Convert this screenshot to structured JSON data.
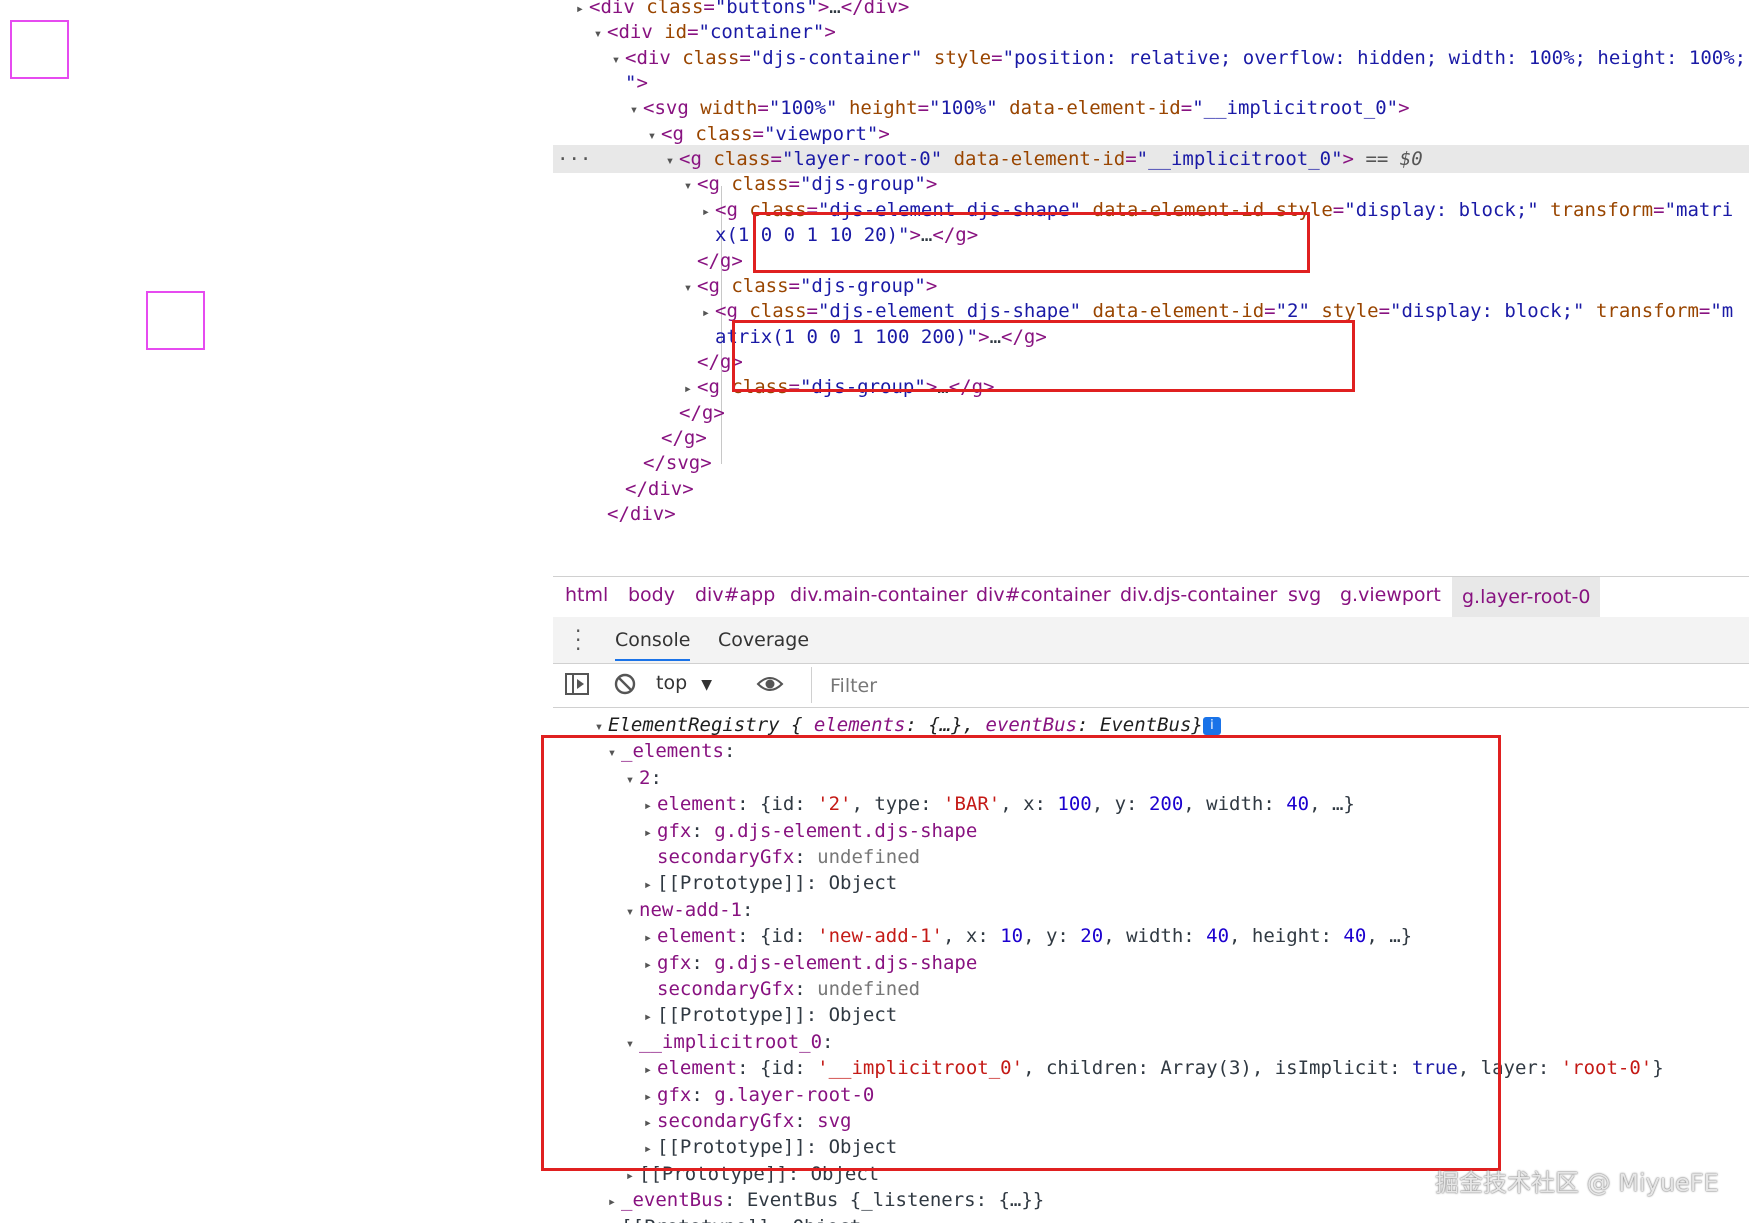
{
  "elements_panel": {
    "lines": [
      {
        "ind": 0,
        "tri": "▸",
        "parts": [
          [
            "tag",
            "<div "
          ],
          [
            "an",
            "class"
          ],
          [
            "tag",
            "="
          ],
          [
            "av",
            "\"buttons\""
          ],
          [
            "tag",
            ">"
          ],
          [
            "pl",
            "…"
          ],
          [
            "tag",
            "</div>"
          ]
        ]
      },
      {
        "ind": 1,
        "tri": "▾",
        "parts": [
          [
            "tag",
            "<div "
          ],
          [
            "an",
            "id"
          ],
          [
            "tag",
            "="
          ],
          [
            "av",
            "\"container\""
          ],
          [
            "tag",
            ">"
          ]
        ]
      },
      {
        "ind": 2,
        "tri": "▾",
        "parts": [
          [
            "tag",
            "<div "
          ],
          [
            "an",
            "class"
          ],
          [
            "tag",
            "="
          ],
          [
            "av",
            "\"djs-container\""
          ],
          [
            "tag",
            " "
          ],
          [
            "an",
            "style"
          ],
          [
            "tag",
            "="
          ],
          [
            "av",
            "\"position: relative; overflow: hidden; width: 100%; height: 100%;"
          ]
        ]
      },
      {
        "ind": 2,
        "tri": "",
        "parts": [
          [
            "av",
            "\""
          ],
          [
            "tag",
            ">"
          ]
        ]
      },
      {
        "ind": 3,
        "tri": "▾",
        "parts": [
          [
            "tag",
            "<svg "
          ],
          [
            "an",
            "width"
          ],
          [
            "tag",
            "="
          ],
          [
            "av",
            "\"100%\""
          ],
          [
            "tag",
            " "
          ],
          [
            "an",
            "height"
          ],
          [
            "tag",
            "="
          ],
          [
            "av",
            "\"100%\""
          ],
          [
            "tag",
            " "
          ],
          [
            "an",
            "data-element-id"
          ],
          [
            "tag",
            "="
          ],
          [
            "av",
            "\"__implicitroot_0\""
          ],
          [
            "tag",
            ">"
          ]
        ]
      },
      {
        "ind": 4,
        "tri": "▾",
        "parts": [
          [
            "tag",
            "<g "
          ],
          [
            "an",
            "class"
          ],
          [
            "tag",
            "="
          ],
          [
            "av",
            "\"viewport\""
          ],
          [
            "tag",
            ">"
          ]
        ]
      },
      {
        "ind": 5,
        "tri": "▾",
        "selected": true,
        "parts": [
          [
            "tag",
            "<g "
          ],
          [
            "an",
            "class"
          ],
          [
            "tag",
            "="
          ],
          [
            "av",
            "\"layer-root-0\""
          ],
          [
            "tag",
            " "
          ],
          [
            "an",
            "data-element-id"
          ],
          [
            "tag",
            "="
          ],
          [
            "av",
            "\"__implicitroot_0\""
          ],
          [
            "tag",
            ">"
          ],
          [
            "eq",
            " == $0"
          ]
        ]
      },
      {
        "ind": 6,
        "tri": "▾",
        "parts": [
          [
            "tag",
            "<g "
          ],
          [
            "an",
            "class"
          ],
          [
            "tag",
            "="
          ],
          [
            "av",
            "\"djs-group\""
          ],
          [
            "tag",
            ">"
          ]
        ]
      },
      {
        "ind": 7,
        "tri": "▸",
        "parts": [
          [
            "tag",
            "<g "
          ],
          [
            "an",
            "class"
          ],
          [
            "tag",
            "="
          ],
          [
            "av",
            "\"djs-element djs-shape\""
          ],
          [
            "tag",
            " "
          ],
          [
            "an",
            "data-element-id"
          ],
          [
            "tag",
            " "
          ],
          [
            "an",
            "style"
          ],
          [
            "tag",
            "="
          ],
          [
            "av",
            "\"display: block;\""
          ],
          [
            "tag",
            " "
          ],
          [
            "an",
            "transform"
          ],
          [
            "tag",
            "="
          ],
          [
            "av",
            "\"matri"
          ]
        ]
      },
      {
        "ind": 7,
        "tri": "",
        "parts": [
          [
            "av",
            "x(1 0 0 1 10 20)\""
          ],
          [
            "tag",
            ">"
          ],
          [
            "pl",
            "…"
          ],
          [
            "tag",
            "</g>"
          ]
        ]
      },
      {
        "ind": 6,
        "tri": "",
        "parts": [
          [
            "tag",
            "</g>"
          ]
        ]
      },
      {
        "ind": 6,
        "tri": "▾",
        "parts": [
          [
            "tag",
            "<g "
          ],
          [
            "an",
            "class"
          ],
          [
            "tag",
            "="
          ],
          [
            "av",
            "\"djs-group\""
          ],
          [
            "tag",
            ">"
          ]
        ]
      },
      {
        "ind": 7,
        "tri": "▸",
        "parts": [
          [
            "tag",
            "<g "
          ],
          [
            "an",
            "class"
          ],
          [
            "tag",
            "="
          ],
          [
            "av",
            "\"djs-element djs-shape\""
          ],
          [
            "tag",
            " "
          ],
          [
            "an",
            "data-element-id"
          ],
          [
            "tag",
            "="
          ],
          [
            "av",
            "\"2\""
          ],
          [
            "tag",
            " "
          ],
          [
            "an",
            "style"
          ],
          [
            "tag",
            "="
          ],
          [
            "av",
            "\"display: block;\""
          ],
          [
            "tag",
            " "
          ],
          [
            "an",
            "transform"
          ],
          [
            "tag",
            "="
          ],
          [
            "av",
            "\"m"
          ]
        ]
      },
      {
        "ind": 7,
        "tri": "",
        "parts": [
          [
            "av",
            "atrix(1 0 0 1 100 200)\""
          ],
          [
            "tag",
            ">"
          ],
          [
            "pl",
            "…"
          ],
          [
            "tag",
            "</g>"
          ]
        ]
      },
      {
        "ind": 6,
        "tri": "",
        "parts": [
          [
            "tag",
            "</g>"
          ]
        ]
      },
      {
        "ind": 6,
        "tri": "▸",
        "parts": [
          [
            "tag",
            "<g "
          ],
          [
            "an",
            "class"
          ],
          [
            "tag",
            "="
          ],
          [
            "av",
            "\"djs-group\""
          ],
          [
            "tag",
            ">"
          ],
          [
            "pl",
            "…"
          ],
          [
            "tag",
            "</g>"
          ]
        ]
      },
      {
        "ind": 5,
        "tri": "",
        "parts": [
          [
            "tag",
            "</g>"
          ]
        ]
      },
      {
        "ind": 4,
        "tri": "",
        "parts": [
          [
            "tag",
            "</g>"
          ]
        ]
      },
      {
        "ind": 3,
        "tri": "",
        "parts": [
          [
            "tag",
            "</svg>"
          ]
        ]
      },
      {
        "ind": 2,
        "tri": "",
        "parts": [
          [
            "tag",
            "</div>"
          ]
        ]
      },
      {
        "ind": 1,
        "tri": "",
        "parts": [
          [
            "tag",
            "</div>"
          ]
        ]
      }
    ],
    "more_dots": "···"
  },
  "breadcrumbs": [
    "html",
    "body",
    "div#app",
    "div.main-container",
    "div#container",
    "div.djs-container",
    "svg",
    "g.viewport",
    "g.layer-root-0"
  ],
  "drawer_tabs": [
    "Console",
    "Coverage"
  ],
  "toolbar": {
    "context": "top",
    "filter_placeholder": "Filter"
  },
  "console": {
    "lines": [
      {
        "ind": 0,
        "tri": "▾",
        "parts": [
          [
            "it",
            "ElementRegistry {"
          ],
          [
            "it",
            " "
          ],
          [
            "itk",
            "elements"
          ],
          [
            "it",
            ": {…}, "
          ],
          [
            "itk",
            "eventBus"
          ],
          [
            "it",
            ": EventBus}"
          ],
          [
            "info",
            "i"
          ]
        ]
      },
      {
        "ind": 1,
        "tri": "▾",
        "parts": [
          [
            "k",
            "_elements"
          ],
          [
            "pl",
            ":"
          ]
        ]
      },
      {
        "ind": 2,
        "tri": "▾",
        "parts": [
          [
            "k",
            "2"
          ],
          [
            "pl",
            ":"
          ]
        ]
      },
      {
        "ind": 3,
        "tri": "▸",
        "parts": [
          [
            "k",
            "element"
          ],
          [
            "pl",
            ": {id: "
          ],
          [
            "str",
            "'2'"
          ],
          [
            "pl",
            ", type: "
          ],
          [
            "str",
            "'BAR'"
          ],
          [
            "pl",
            ", x: "
          ],
          [
            "num",
            "100"
          ],
          [
            "pl",
            ", y: "
          ],
          [
            "num",
            "200"
          ],
          [
            "pl",
            ", width: "
          ],
          [
            "num",
            "40"
          ],
          [
            "pl",
            ", …}"
          ]
        ]
      },
      {
        "ind": 3,
        "tri": "▸",
        "parts": [
          [
            "k",
            "gfx"
          ],
          [
            "pl",
            ": "
          ],
          [
            "k",
            "g.djs-element.djs-shape"
          ]
        ]
      },
      {
        "ind": 3,
        "tri": "",
        "parts": [
          [
            "k",
            "secondaryGfx"
          ],
          [
            "pl",
            ": "
          ],
          [
            "undef",
            "undefined"
          ]
        ]
      },
      {
        "ind": 3,
        "tri": "▸",
        "parts": [
          [
            "pl",
            "[[Prototype]]: Object"
          ]
        ]
      },
      {
        "ind": 2,
        "tri": "▾",
        "parts": [
          [
            "k",
            "new-add-1"
          ],
          [
            "pl",
            ":"
          ]
        ]
      },
      {
        "ind": 3,
        "tri": "▸",
        "parts": [
          [
            "k",
            "element"
          ],
          [
            "pl",
            ": {id: "
          ],
          [
            "str",
            "'new-add-1'"
          ],
          [
            "pl",
            ", x: "
          ],
          [
            "num",
            "10"
          ],
          [
            "pl",
            ", y: "
          ],
          [
            "num",
            "20"
          ],
          [
            "pl",
            ", width: "
          ],
          [
            "num",
            "40"
          ],
          [
            "pl",
            ", height: "
          ],
          [
            "num",
            "40"
          ],
          [
            "pl",
            ", …}"
          ]
        ]
      },
      {
        "ind": 3,
        "tri": "▸",
        "parts": [
          [
            "k",
            "gfx"
          ],
          [
            "pl",
            ": "
          ],
          [
            "k",
            "g.djs-element.djs-shape"
          ]
        ]
      },
      {
        "ind": 3,
        "tri": "",
        "parts": [
          [
            "k",
            "secondaryGfx"
          ],
          [
            "pl",
            ": "
          ],
          [
            "undef",
            "undefined"
          ]
        ]
      },
      {
        "ind": 3,
        "tri": "▸",
        "parts": [
          [
            "pl",
            "[[Prototype]]: Object"
          ]
        ]
      },
      {
        "ind": 2,
        "tri": "▾",
        "parts": [
          [
            "k",
            "__implicitroot_0"
          ],
          [
            "pl",
            ":"
          ]
        ]
      },
      {
        "ind": 3,
        "tri": "▸",
        "parts": [
          [
            "k",
            "element"
          ],
          [
            "pl",
            ": {id: "
          ],
          [
            "str",
            "'__implicitroot_0'"
          ],
          [
            "pl",
            ", children: Array(3), isImplicit: "
          ],
          [
            "kw",
            "true"
          ],
          [
            "pl",
            ", layer: "
          ],
          [
            "str",
            "'root-0'"
          ],
          [
            "pl",
            "}"
          ]
        ]
      },
      {
        "ind": 3,
        "tri": "▸",
        "parts": [
          [
            "k",
            "gfx"
          ],
          [
            "pl",
            ": "
          ],
          [
            "k",
            "g.layer-root-0"
          ]
        ]
      },
      {
        "ind": 3,
        "tri": "▸",
        "parts": [
          [
            "k",
            "secondaryGfx"
          ],
          [
            "pl",
            ": "
          ],
          [
            "k",
            "svg"
          ]
        ]
      },
      {
        "ind": 3,
        "tri": "▸",
        "parts": [
          [
            "pl",
            "[[Prototype]]: Object"
          ]
        ]
      },
      {
        "ind": 2,
        "tri": "▸",
        "parts": [
          [
            "pl",
            "[[Prototype]]: Object"
          ]
        ]
      },
      {
        "ind": 1,
        "tri": "▸",
        "parts": [
          [
            "k",
            "_eventBus"
          ],
          [
            "pl",
            ": EventBus {_listeners: {…}}"
          ]
        ]
      },
      {
        "ind": 1,
        "tri": "▸",
        "parts": [
          [
            "pl",
            "[[Prototype]]: Object"
          ]
        ]
      }
    ]
  },
  "watermark": "掘金技术社区 @ MiyueFE",
  "colors": {
    "shape_stroke": "#e64bf0",
    "highlight_box": "#e02020",
    "selected_row": "#e8e8e8"
  }
}
